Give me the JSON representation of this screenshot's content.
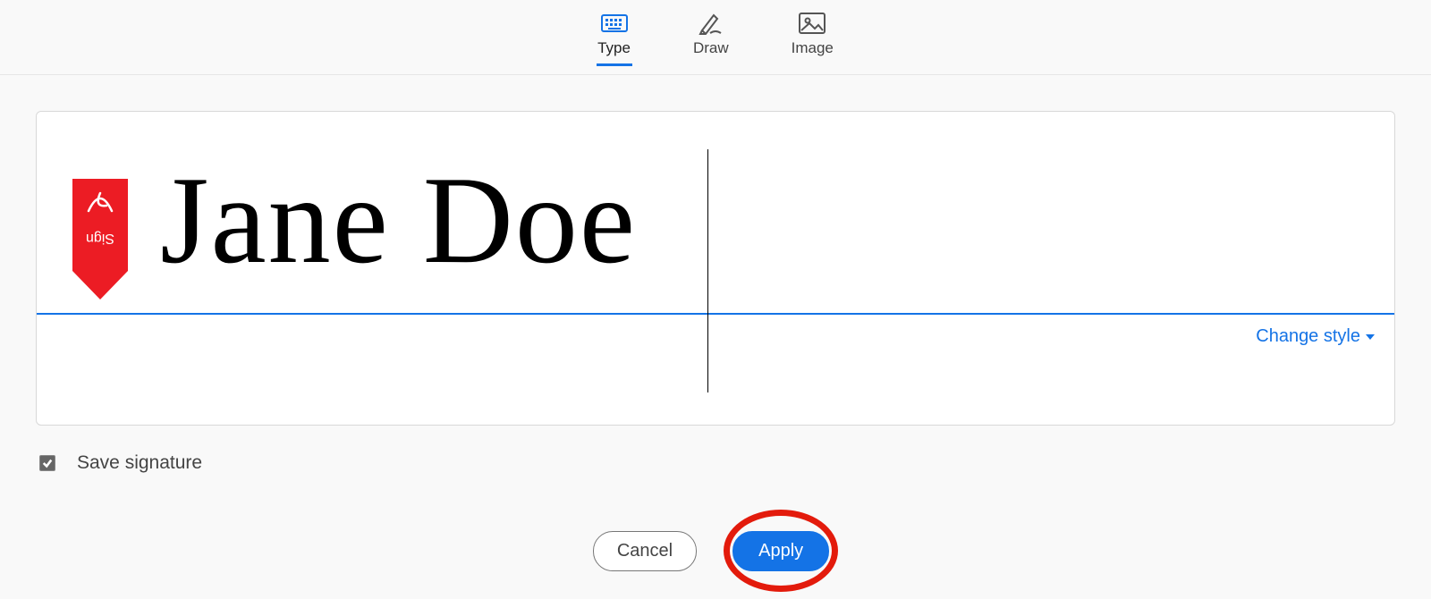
{
  "tabs": [
    {
      "id": "type",
      "label": "Type",
      "active": true
    },
    {
      "id": "draw",
      "label": "Draw",
      "active": false
    },
    {
      "id": "image",
      "label": "Image",
      "active": false
    }
  ],
  "signature": {
    "text": "Jane Doe",
    "badge_label": "Sign",
    "change_style_label": "Change style"
  },
  "save_checkbox": {
    "checked": true,
    "label": "Save signature"
  },
  "buttons": {
    "cancel": "Cancel",
    "apply": "Apply"
  },
  "colors": {
    "accent": "#1473e6",
    "highlight_ring": "#e31b0c"
  }
}
